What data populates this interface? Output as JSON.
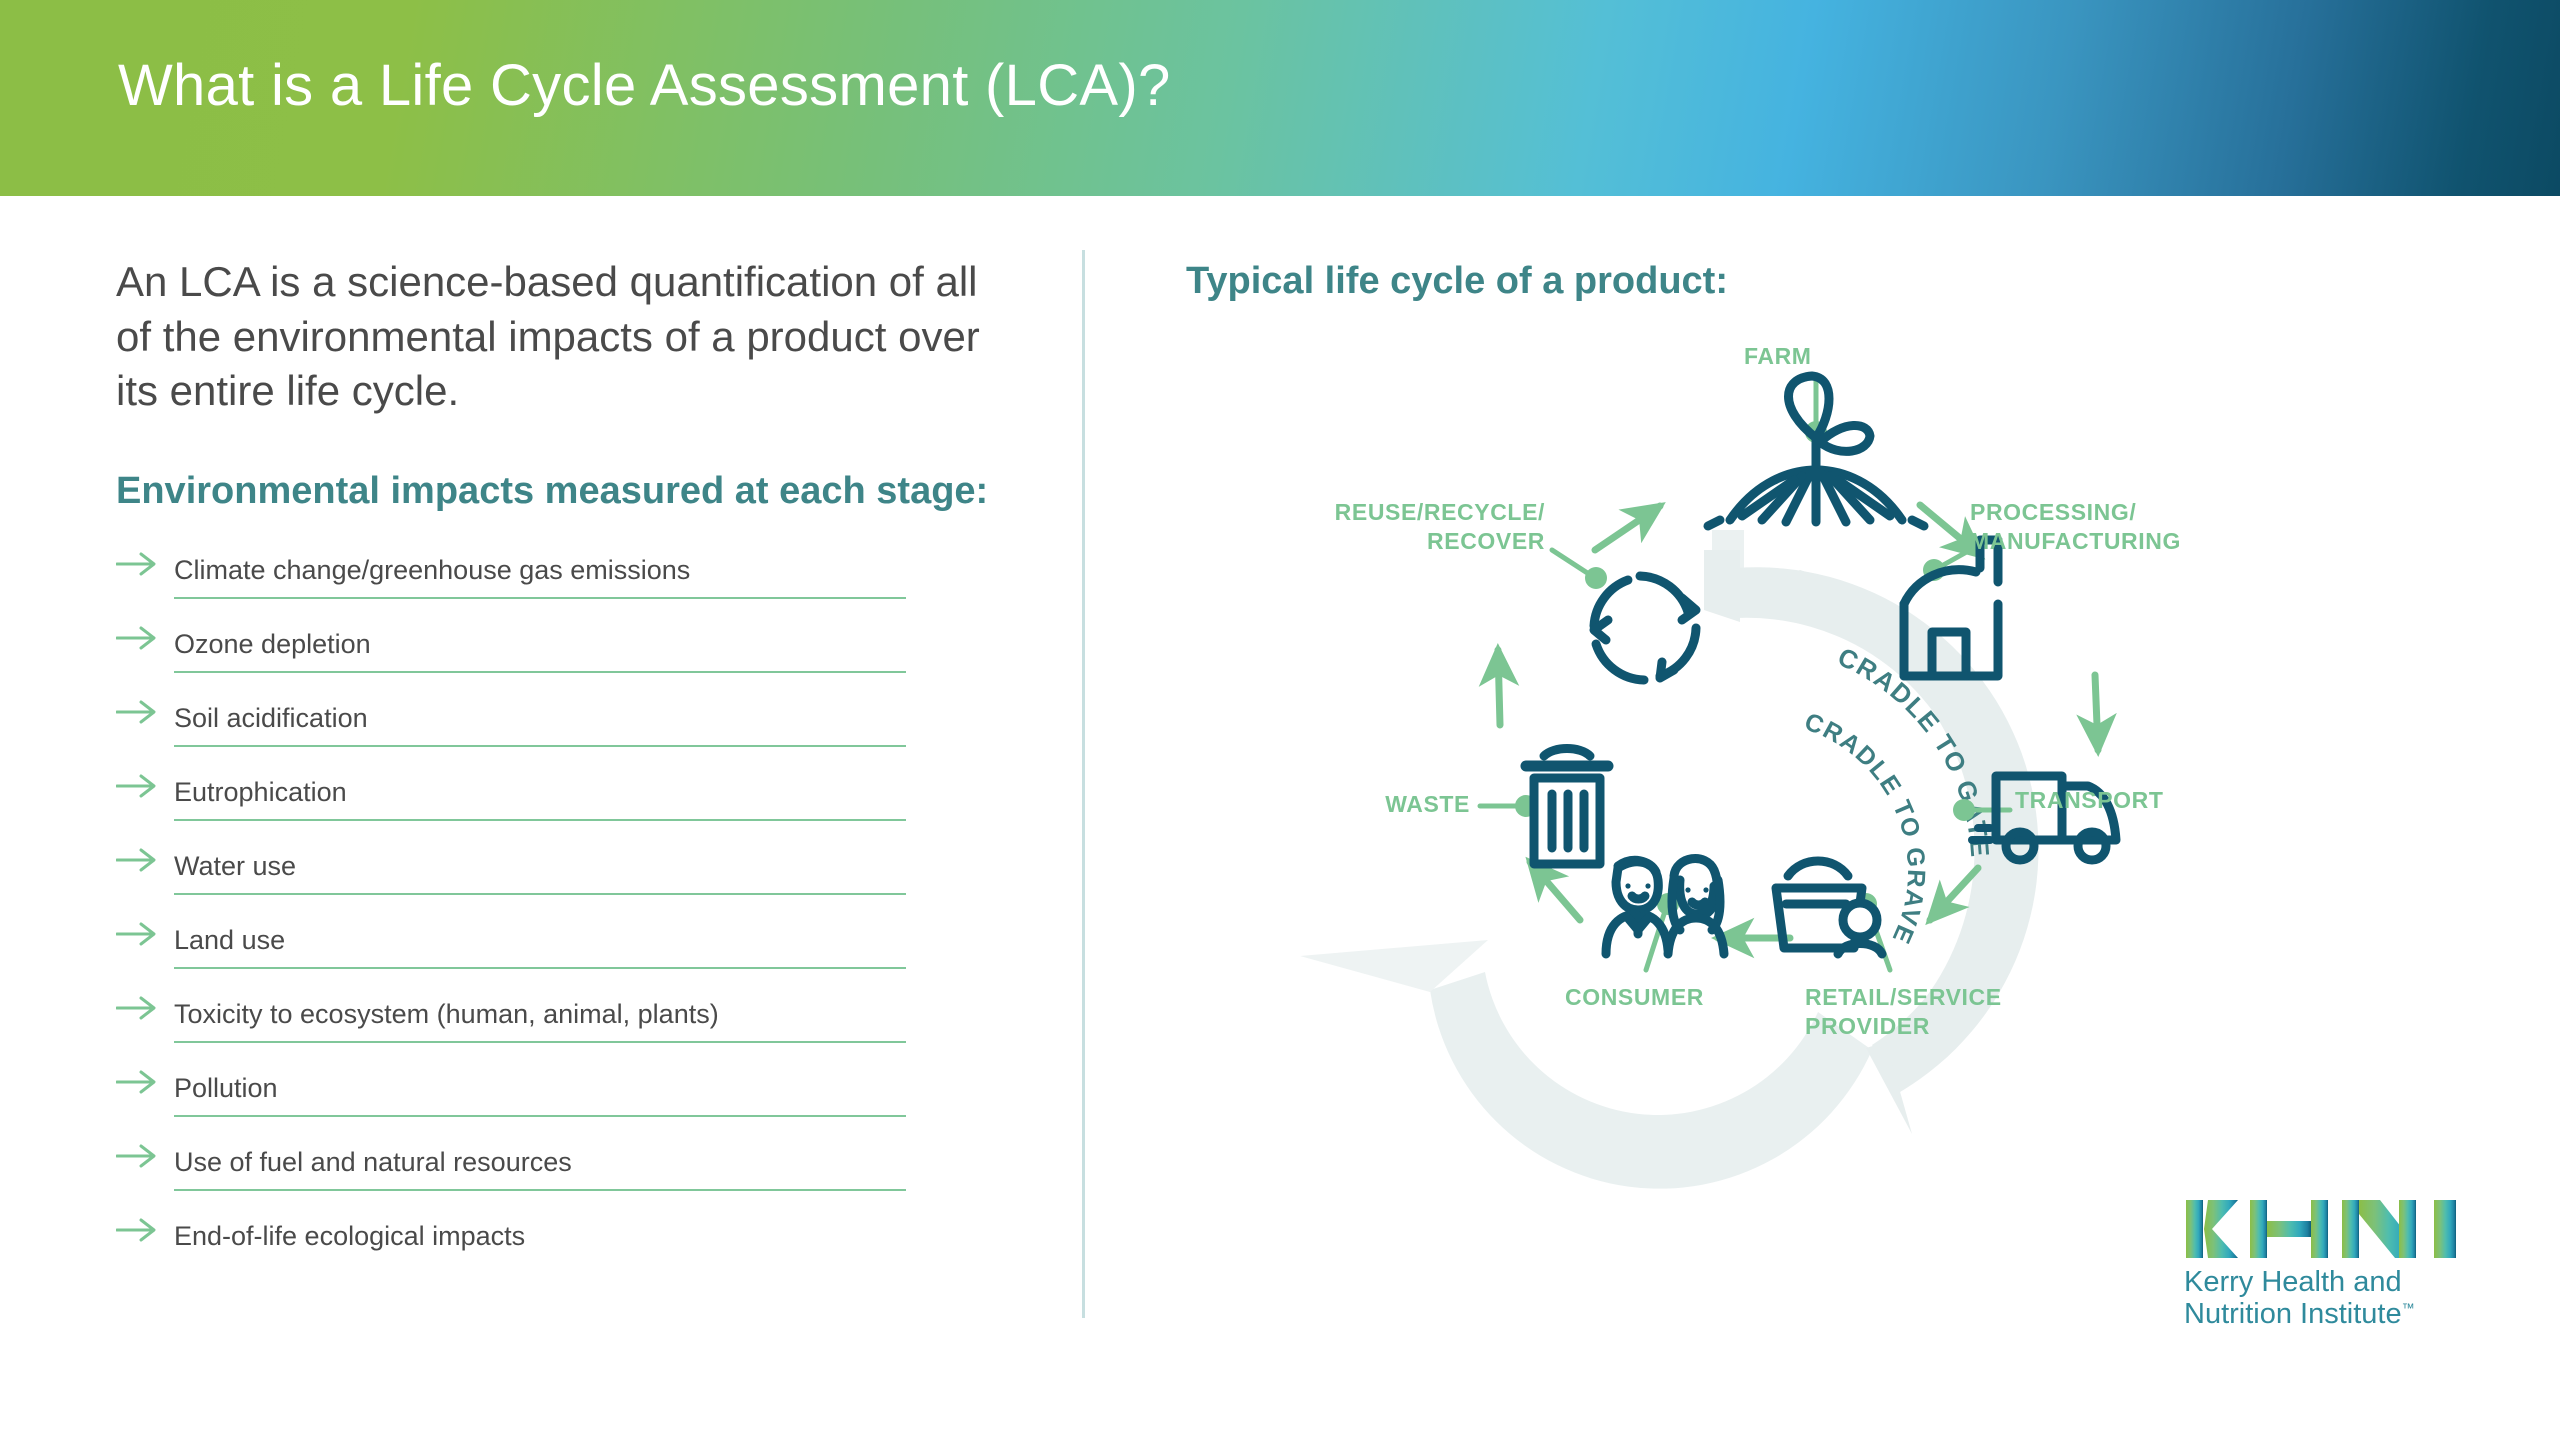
{
  "header": {
    "title": "What is a Life Cycle Assessment (LCA)?"
  },
  "left": {
    "intro": "An LCA is a science-based quantification of all of the environmental impacts of a product over its entire life cycle.",
    "impacts_heading": "Environmental impacts measured at each stage:",
    "impacts": [
      "Climate change/greenhouse gas emissions",
      "Ozone depletion",
      "Soil acidification",
      "Eutrophication",
      "Water use",
      "Land use",
      "Toxicity to ecosystem (human, animal, plants)",
      "Pollution",
      "Use of fuel and natural resources",
      "End-of-life ecological impacts"
    ]
  },
  "diagram": {
    "heading": "Typical life cycle of a product:",
    "arc_outer_label": "CRADLE TO GATE",
    "arc_inner_label": "CRADLE TO GRAVE",
    "nodes": {
      "farm": "FARM",
      "processing": "PROCESSING/\nMANUFACTURING",
      "transport": "TRANSPORT",
      "retail": "RETAIL/SERVICE\nPROVIDER",
      "consumer": "CONSUMER",
      "waste": "WASTE",
      "reuse": "REUSE/RECYCLE/\nRECOVER"
    }
  },
  "logo": {
    "mark": "KHNI",
    "name": "Kerry Health and\nNutrition Institute",
    "trademark": "™"
  },
  "colors": {
    "green_accent": "#7cc593",
    "teal_heading": "#3e8588",
    "icon_navy": "#10556f",
    "rule_green": "#80c79a",
    "arc_fill": "#e6eeee",
    "body_text": "#4a4a4a",
    "divider": "#c7dfe0"
  }
}
